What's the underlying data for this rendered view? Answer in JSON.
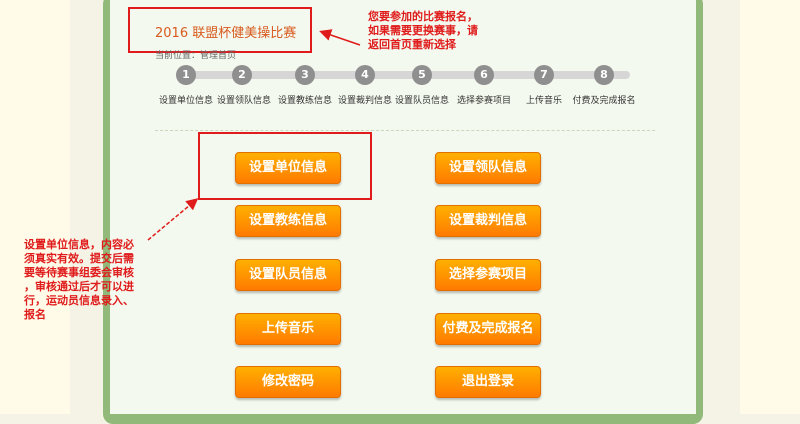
{
  "header": {
    "contest_title": "2016 联盟杯健美操比赛",
    "breadcrumb": "当前位置：管理首页"
  },
  "steps": [
    {
      "number": "1",
      "label": "设置单位信息"
    },
    {
      "number": "2",
      "label": "设置领队信息"
    },
    {
      "number": "3",
      "label": "设置教练信息"
    },
    {
      "number": "4",
      "label": "设置裁判信息"
    },
    {
      "number": "5",
      "label": "设置队员信息"
    },
    {
      "number": "6",
      "label": "选择参赛项目"
    },
    {
      "number": "7",
      "label": "上传音乐"
    },
    {
      "number": "8",
      "label": "付费及完成报名"
    }
  ],
  "buttons": {
    "unit_info": "设置单位信息",
    "leader_info": "设置领队信息",
    "coach_info": "设置教练信息",
    "judge_info": "设置裁判信息",
    "member_info": "设置队员信息",
    "select_events": "选择参赛项目",
    "upload_music": "上传音乐",
    "pay_complete": "付费及完成报名",
    "change_password": "修改密码",
    "logout": "退出登录"
  },
  "annotations": {
    "top_note": "您要参加的比赛报名，\n如果需要更换赛事，请\n返回首页重新选择",
    "left_note": "设置单位信息，内容必\n须真实有效。提交后需\n要等待赛事组委会审核\n，审核通过后才可以进\n行，运动员信息录入、\n报名"
  },
  "colors": {
    "accent": "#ff8c00",
    "annotation": "#e01b1b",
    "panel_border": "#91b97a"
  }
}
